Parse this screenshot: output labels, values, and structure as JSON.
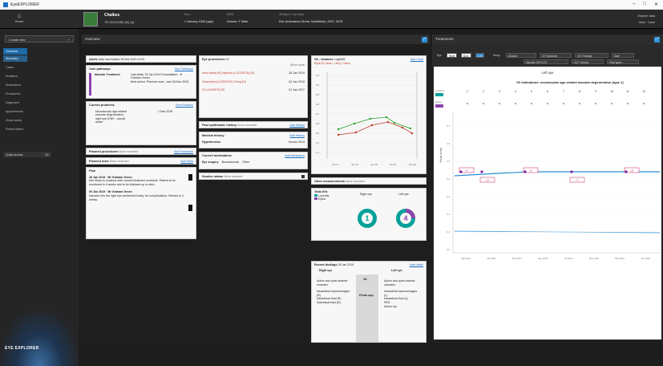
{
  "window": {
    "title": "EyeEXPLORER"
  },
  "header": {
    "home_label": "Home",
    "patient_name": "Chalkes",
    "patient_id": "TD 00123456 (M) (a)",
    "field1_label": "Born",
    "field1_value": "1 January 1943 (age)",
    "field2_label": "MRN",
    "field2_value": "Gender: F Male",
    "field3_label": "Allergies / warnings",
    "field3_value": "Ref: Ambulance Street, Northfields, 2007, 2075",
    "right1": "Explore data",
    "right2": "View",
    "right3": "Case"
  },
  "sidebar": {
    "create_label": "Create new",
    "items": [
      "Overview",
      "Summary",
      "Cases",
      "Problems",
      "Medications",
      "Procedures",
      "Diagnoses",
      "Appointments",
      "Visual acuity",
      "Recent letters"
    ],
    "quick_label": "Quick access",
    "logo": "EYE EXPLORER"
  },
  "overview": {
    "title": "Overview",
    "alerts": {
      "title": "Alerts",
      "text": "Date last treated 18 Nov 2019 11:00"
    },
    "care": {
      "title": "Care pathways",
      "link": "See Pathways",
      "item1": "Macular Treatment",
      "detail1": "Last visits: 20 Jan 2019 Consultation - N Graham Green",
      "detail2": "Next action: Planned scan - due 28 Nov 2019"
    },
    "problems": {
      "title": "Current problems",
      "link": "View Problem",
      "item": "Neovascular age-related macular degeneration, right eye (CNV - occult) active",
      "date": "1 Mar 2018"
    },
    "procedures": {
      "title": "Planned procedures",
      "text": "None recorded",
      "link": "Add Procedure"
    },
    "tests": {
      "title": "Planned tests",
      "text": "None recorded",
      "link": "Add Tests"
    },
    "plan": {
      "title": "Plan",
      "e1_date": "28 Jan 2019",
      "e1_by": "Mr Graham Green",
      "e1_text": "Mrs Shaw to continue with current treatment schedule. Patient to be monitored in 4 weeks and to be followed up in clinic.",
      "e2_date": "09 Jan 2019",
      "e2_by": "Mr Graham Green",
      "e2_text": "Injection into the right eye performed today. No complications. Review in 4 weeks."
    },
    "eye": {
      "title": "Eye procedures",
      "count": "15",
      "link": "Show more",
      "rows": [
        "Intra-vitreal (R) injection (LUCENTIS) (R)",
        "Intravitreal (LUCENTIS) 0.5mg (R)",
        "IV LUCENTIS (R)"
      ],
      "dates": [
        "28 Jan 2019",
        "02 Jan 2019",
        "01 Jan 2017"
      ]
    },
    "ophthal": {
      "title": "Past ophthalmic history",
      "text": "None recorded",
      "link": "Add History"
    },
    "medhx": {
      "title": "Medical history",
      "link": "Add History",
      "row": "Hypertension",
      "date": "Known 2013"
    },
    "meds": {
      "title": "Current medications",
      "link": "Add Medication",
      "row": "Eye surgery",
      "c1": "Bevacizumab",
      "c2": "Other"
    },
    "smoke": {
      "title": "Smoker status",
      "text": "Never smoked"
    },
    "va": {
      "title": "VA - distance",
      "mode": "LogMAR",
      "link": "Add Chart",
      "right": "Right (R) Vision",
      "left": "Left (L) Vision",
      "ylabels": [
        "0.3",
        "0.4",
        "0.5",
        "0.6",
        "0.7",
        "0.8",
        "0.9",
        "1.0",
        "1.1"
      ],
      "xlabels": [
        "Oct 17",
        "Jan 18",
        "Apr 18",
        "Jul 18",
        "Oct 18"
      ]
    },
    "other": {
      "title": "Other measurements",
      "text": "None recorded"
    },
    "total": {
      "title": "Total IVIs",
      "legend1": "Lucentis",
      "legend2": "Eylea",
      "right_label": "Right eye",
      "left_label": "Left eye",
      "right_n": "1",
      "left_n": "4"
    },
    "findings": {
      "title": "Recent findings",
      "date": "28 Jan 2019",
      "link": "View detail",
      "right": "Right eye",
      "left": "Left eye",
      "r1": "Active and quiet anterior chamber",
      "r2": "Intraretinal haemorrhages (R)",
      "r3": "Intraretinal fluid (R)",
      "r4": "Subretinal fluid (R)",
      "va_label": "VA",
      "photo_label": "Photo sup",
      "l1": "Active and quiet anterior chamber",
      "l2": "Intraretinal haemorrhages (L)",
      "l3": "Intraretinal fluid (L)",
      "l4": "PED",
      "l5": "Active dry"
    }
  },
  "treatment": {
    "title": "Treatments",
    "chips": [
      "Eye",
      "Right",
      "Both",
      "Left",
      "Group",
      "All data",
      "IVT injections",
      "OCT findings",
      "Date"
    ],
    "chips2": [
      "Macular CMT/CST",
      "OCT Volume",
      "Fluid types"
    ],
    "chart_title": "Left eye",
    "subtitle": "IVI indications: neovascular age-related macular degeneration (type 1)",
    "ylabel": "Visual acuity",
    "row_labels": [
      "Lucentis",
      "Eylea"
    ],
    "markers": [
      "1",
      "2",
      "3",
      "4",
      "5",
      "6",
      "7",
      "8",
      "9",
      "10",
      "11",
      "12"
    ],
    "tags": [
      "L4",
      "L5",
      "L6",
      "L7",
      "L8"
    ],
    "x_dates": [
      "Mar 2016",
      "Jan 2017",
      "Nov 2017",
      "Sep 2018",
      "Jul 2019",
      "May 2020",
      "Mar 2021",
      "Jan 2022"
    ],
    "y_ticks": [
      "0.0",
      "0.1",
      "0.2",
      "0.3",
      "0.4",
      "0.5",
      "0.6",
      "0.7"
    ]
  }
}
